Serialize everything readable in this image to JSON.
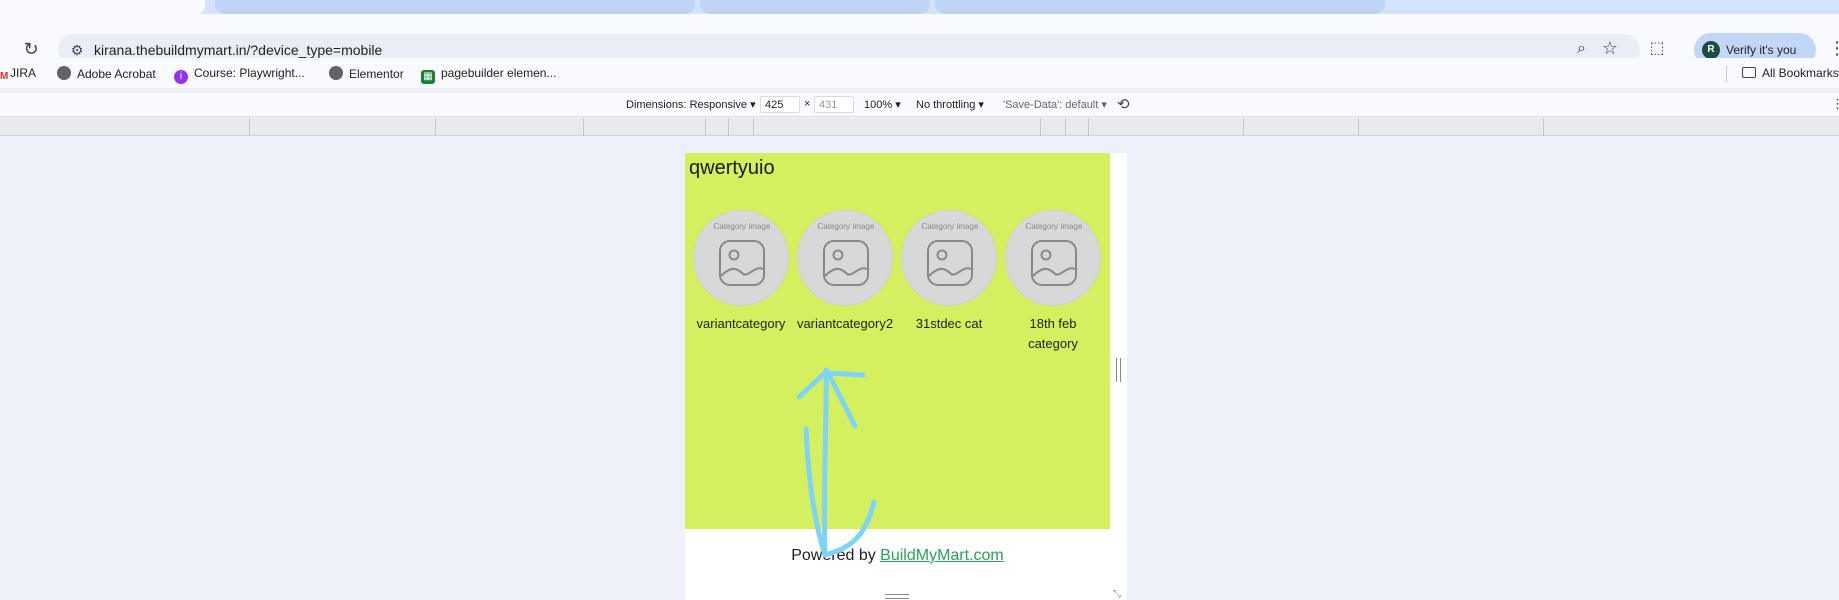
{
  "browser": {
    "url": "kirana.thebuildmymart.in/?device_type=mobile",
    "profile_button": "Verify it's you",
    "profile_initial": "R"
  },
  "bookmarks": [
    {
      "label": "JIRA",
      "icon": "gmail-icon"
    },
    {
      "label": "Adobe Acrobat",
      "icon": "globe-icon"
    },
    {
      "label": "Course: Playwright...",
      "icon": "course-icon"
    },
    {
      "label": "Elementor",
      "icon": "globe-icon"
    },
    {
      "label": "pagebuilder elemen...",
      "icon": "sheets-icon"
    }
  ],
  "all_bookmarks": "All Bookmarks",
  "devtools": {
    "dimensions": "Dimensions: Responsive",
    "width": "425",
    "times": "×",
    "height": "431",
    "zoom": "100%",
    "throttling": "No throttling",
    "save_data": "'Save-Data': default"
  },
  "page": {
    "title": "qwertyuio",
    "image_caption": "Category Image",
    "categories": [
      {
        "name": "variantcategory"
      },
      {
        "name": "variantcategory2"
      },
      {
        "name": "31stdec cat"
      },
      {
        "name": "18th feb category"
      }
    ],
    "footer_prefix": "Powered by ",
    "footer_link": "BuildMyMart.com"
  },
  "colors": {
    "page_bg": "#d5f05e",
    "link": "#2aa05a",
    "annotation": "#7fd3f7"
  }
}
